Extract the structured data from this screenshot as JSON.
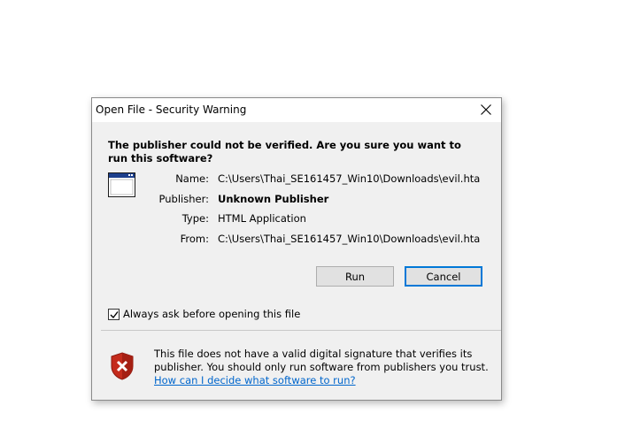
{
  "dialog": {
    "title": "Open File - Security Warning",
    "heading": "The publisher could not be verified.  Are you sure you want to run this software?",
    "fields": [
      {
        "label": "Name:",
        "value": "C:\\Users\\Thai_SE161457_Win10\\Downloads\\evil.hta"
      },
      {
        "label": "Publisher:",
        "value": "Unknown Publisher"
      },
      {
        "label": "Type:",
        "value": "HTML Application"
      },
      {
        "label": "From:",
        "value": "C:\\Users\\Thai_SE161457_Win10\\Downloads\\evil.hta"
      }
    ],
    "buttons": {
      "run": "Run",
      "cancel": "Cancel"
    },
    "checkbox": {
      "label": "Always ask before opening this file",
      "checked": true
    },
    "warning": {
      "text": "This file does not have a valid digital signature that verifies its publisher.  You should only run software from publishers you trust.",
      "link": "How can I decide what software to run?"
    },
    "colors": {
      "accent": "#0078d7",
      "link": "#0066cc",
      "shield_red": "#c42b1c"
    }
  }
}
